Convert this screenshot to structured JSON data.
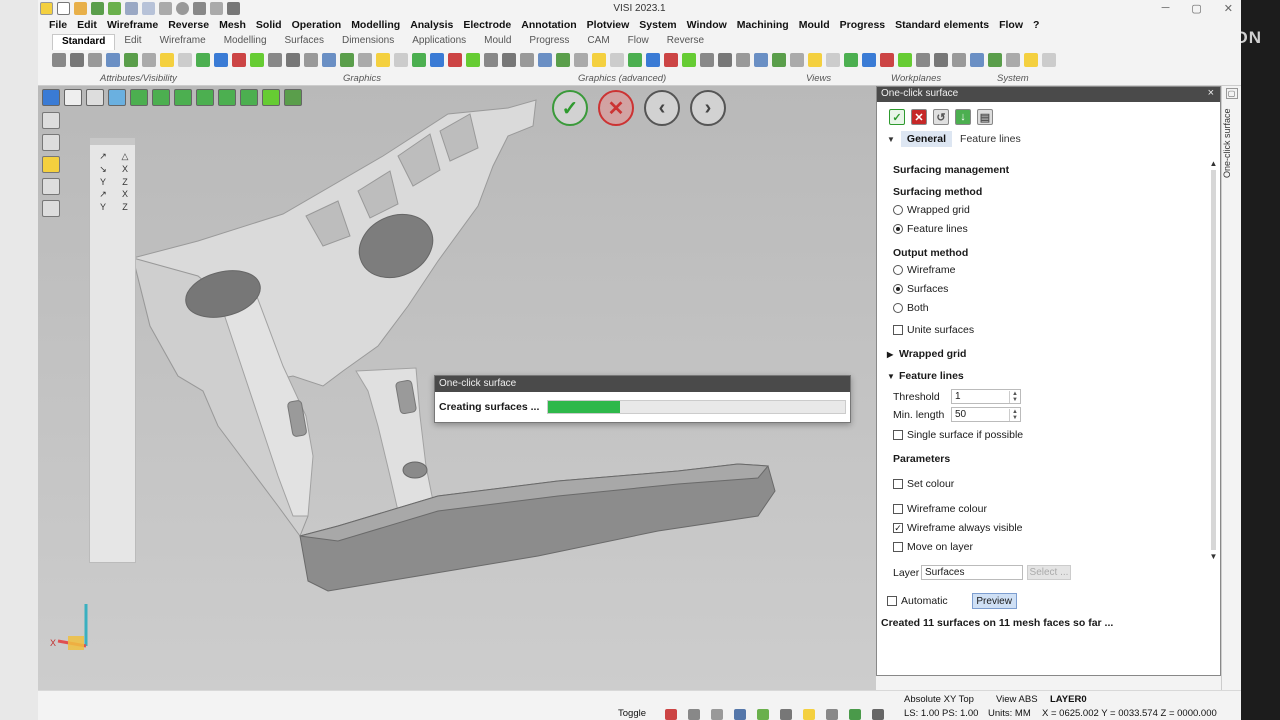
{
  "window": {
    "title": "VISI 2023.1"
  },
  "brand": {
    "logo_text": "HEXAGON"
  },
  "menu": [
    "File",
    "Edit",
    "Wireframe",
    "Reverse",
    "Mesh",
    "Solid",
    "Operation",
    "Modelling",
    "Analysis",
    "Electrode",
    "Annotation",
    "Plotview",
    "System",
    "Window",
    "Machining",
    "Mould",
    "Progress",
    "Standard elements",
    "Flow",
    "?"
  ],
  "ribbon_tabs": [
    {
      "label": "Standard",
      "active": true
    },
    {
      "label": "Edit"
    },
    {
      "label": "Wireframe"
    },
    {
      "label": "Modelling"
    },
    {
      "label": "Surfaces"
    },
    {
      "label": "Dimensions"
    },
    {
      "label": "Applications"
    },
    {
      "label": "Mould"
    },
    {
      "label": "Progress"
    },
    {
      "label": "CAM"
    },
    {
      "label": "Flow"
    },
    {
      "label": "Reverse"
    }
  ],
  "ribbon_groups": [
    "Attributes/Visibility",
    "Graphics",
    "Graphics (advanced)",
    "Views",
    "Workplanes",
    "System"
  ],
  "snap_panel": {
    "items": [
      "↗",
      "△",
      "↘",
      "X",
      "Y",
      "Z",
      "↗",
      "X",
      "Y",
      "Z"
    ]
  },
  "nav": {
    "ok": "✓",
    "cancel": "✕",
    "prev": "‹",
    "next": "›"
  },
  "progress_dialog": {
    "title": "One-click surface",
    "label": "Creating surfaces ...",
    "progress": 0.24
  },
  "ocs": {
    "title": "One-click surface",
    "close": "×",
    "tabs": [
      {
        "label": "General",
        "active": true
      },
      {
        "label": "Feature lines"
      }
    ],
    "surfacing_management": "Surfacing management",
    "surfacing_method": {
      "label": "Surfacing method",
      "options": [
        "Wrapped grid",
        "Feature lines"
      ],
      "selected": "Feature lines"
    },
    "output_method": {
      "label": "Output method",
      "options": [
        "Wireframe",
        "Surfaces",
        "Both"
      ],
      "selected": "Surfaces"
    },
    "unite_surfaces": {
      "label": "Unite surfaces",
      "checked": false
    },
    "wrapped_grid": {
      "label": "Wrapped grid",
      "expanded": false
    },
    "feature_lines": {
      "label": "Feature lines",
      "expanded": true,
      "threshold": {
        "label": "Threshold",
        "value": "1"
      },
      "min_length": {
        "label": "Min. length",
        "value": "50"
      },
      "single_surface": {
        "label": "Single surface if possible",
        "checked": false
      }
    },
    "parameters": {
      "label": "Parameters",
      "set_colour": {
        "label": "Set colour",
        "checked": false
      },
      "wireframe_colour": {
        "label": "Wireframe colour",
        "checked": false
      },
      "wireframe_visible": {
        "label": "Wireframe always visible",
        "checked": true
      },
      "move_on_layer": {
        "label": "Move on layer",
        "checked": false
      }
    },
    "layer": {
      "label": "Layer",
      "value": "Surfaces",
      "select_label": "Select ..."
    },
    "automatic": {
      "label": "Automatic",
      "checked": false
    },
    "preview_label": "Preview",
    "status": "Created 11 surfaces on 11 mesh faces so far ..."
  },
  "side_tab": {
    "label": "One-click surface"
  },
  "statusbar": {
    "view_label": "Absolute XY Top",
    "view_abs": "View ABS",
    "layer": "LAYER0",
    "toggle": "Toggle",
    "ls_ps": "LS: 1.00 PS: 1.00",
    "units": "Units: MM",
    "coords": "X = 0625.002 Y = 0033.574 Z = 0000.000"
  },
  "axes": {
    "x": "X"
  }
}
